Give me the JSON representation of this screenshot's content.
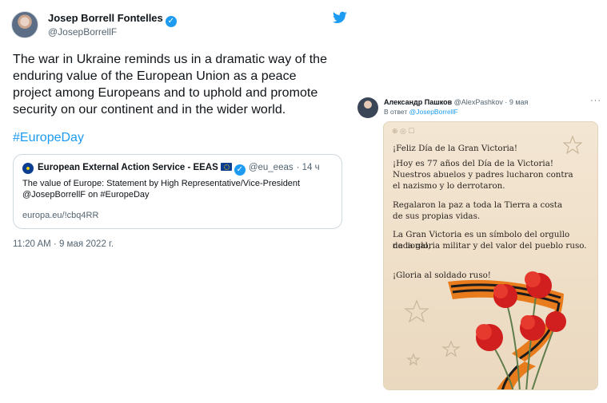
{
  "left_tweet": {
    "author_name": "Josep Borrell Fontelles",
    "author_handle": "@JosepBorrellF",
    "text_lines": [
      "The war in Ukraine reminds us in a dramatic way of the",
      "enduring value of the European Union as a peace",
      "project among Europeans and to uphold and promote",
      "security on our continent and in the wider world."
    ],
    "hashtag": "#EuropeDay",
    "quoted": {
      "name": "European External Action Service - EEAS",
      "handle": "@eu_eeas",
      "age": "· 14 ч",
      "line1": "The value of Europe: Statement by High Representative/Vice-President",
      "line2": "@JosepBorrellF on #EuropeDay",
      "url": "europa.eu/!cbq4RR"
    },
    "timestamp": "11:20 AM · 9 мая 2022 г."
  },
  "right_tweet": {
    "author_name": "Александр Пашков",
    "author_handle": "@AlexPashkov",
    "age": "· 9 мая",
    "reply_prefix": "В ответ",
    "reply_to": "@JosepBorrellF",
    "postcard_lines": [
      "¡Feliz Día de la Gran Victoria!",
      "¡Hoy es 77 años del Día de la Victoria!",
      "Nuestros abuelos y padres lucharon contra",
      "el nazismo y lo derrotaron.",
      "Regalaron la paz a toda la Tierra a costa",
      "de sus propias vidas.",
      "La Gran Victoria es un símbolo del orgullo nacional,",
      "de la gloria militar y del valor del pueblo ruso.",
      "¡Gloria al soldado ruso!"
    ]
  },
  "colors": {
    "accent": "#1d9bf0",
    "text": "#0f1419",
    "muted": "#536471",
    "border": "#cfd9de",
    "ribbon_orange": "#e87b1c",
    "ribbon_black": "#1b1b1b",
    "carnation_red": "#d11f1f"
  },
  "icons": [
    "verified-badge-icon",
    "twitter-bird-icon",
    "eu-flag-icon",
    "more-options-icon",
    "star-icon"
  ]
}
